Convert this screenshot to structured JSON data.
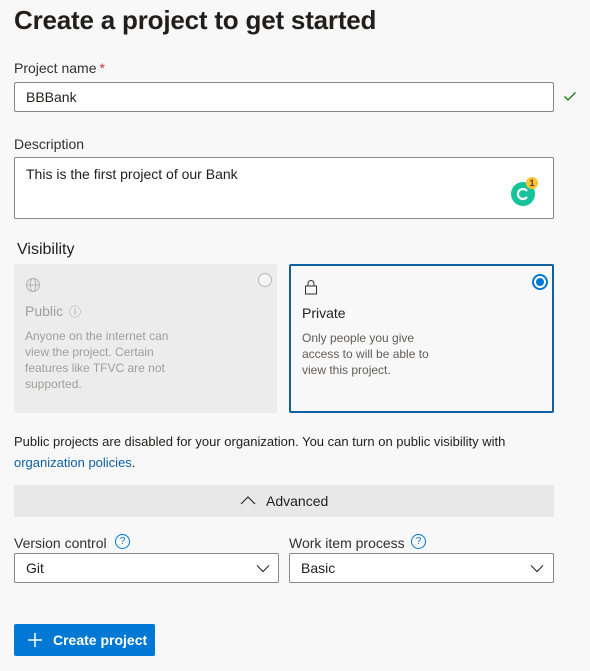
{
  "page": {
    "title": "Create a project to get started"
  },
  "project_name": {
    "label": "Project name",
    "required_mark": "*",
    "value": "BBBank"
  },
  "description": {
    "label": "Description",
    "value": "This is the first project of our Bank",
    "grammarly_count": "1"
  },
  "visibility": {
    "heading": "Visibility",
    "public": {
      "title": "Public",
      "description": "Anyone on the internet can view the project. Certain features like TFVC are not supported.",
      "info_icon": "ⓘ"
    },
    "private": {
      "title": "Private",
      "description": "Only people you give access to will be able to view this project."
    },
    "selected": "private"
  },
  "notice": {
    "text": "Public projects are disabled for your organization. You can turn on public visibility with ",
    "link_text": "organization policies",
    "suffix": "."
  },
  "advanced": {
    "label": "Advanced"
  },
  "version_control": {
    "label": "Version control",
    "value": "Git",
    "help_icon": "?"
  },
  "work_item_process": {
    "label": "Work item process",
    "value": "Basic",
    "help_icon": "?"
  },
  "actions": {
    "create_label": "Create project"
  },
  "colors": {
    "accent": "#0078d4",
    "link": "#0f5fa3",
    "success": "#107c10",
    "required": "#d13438"
  }
}
